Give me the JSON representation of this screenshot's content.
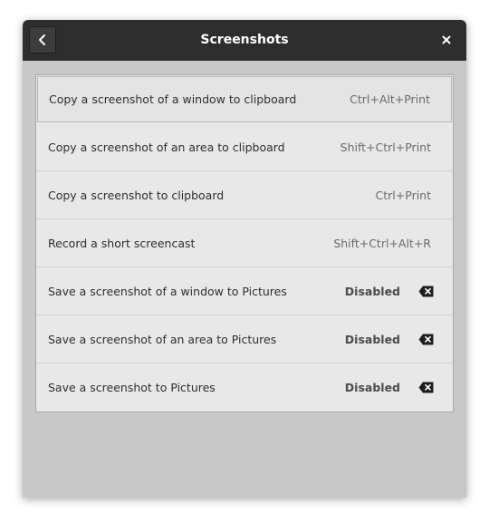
{
  "window": {
    "title": "Screenshots"
  },
  "icons": {
    "back": "chevron-left-icon",
    "close": "close-icon",
    "clear": "backspace-icon"
  },
  "shortcuts": [
    {
      "label": "Copy a screenshot of a window to clipboard",
      "accel": "Ctrl+Alt+Print",
      "disabled": false
    },
    {
      "label": "Copy a screenshot of an area to clipboard",
      "accel": "Shift+Ctrl+Print",
      "disabled": false
    },
    {
      "label": "Copy a screenshot to clipboard",
      "accel": "Ctrl+Print",
      "disabled": false
    },
    {
      "label": "Record a short screencast",
      "accel": "Shift+Ctrl+Alt+R",
      "disabled": false
    },
    {
      "label": "Save a screenshot of a window to Pictures",
      "accel": "Disabled",
      "disabled": true
    },
    {
      "label": "Save a screenshot of an area to Pictures",
      "accel": "Disabled",
      "disabled": true
    },
    {
      "label": "Save a screenshot to Pictures",
      "accel": "Disabled",
      "disabled": true
    }
  ],
  "colors": {
    "titlebar": "#2e2e2e",
    "background": "#c8c8c8",
    "list": "#e8e8e8"
  }
}
